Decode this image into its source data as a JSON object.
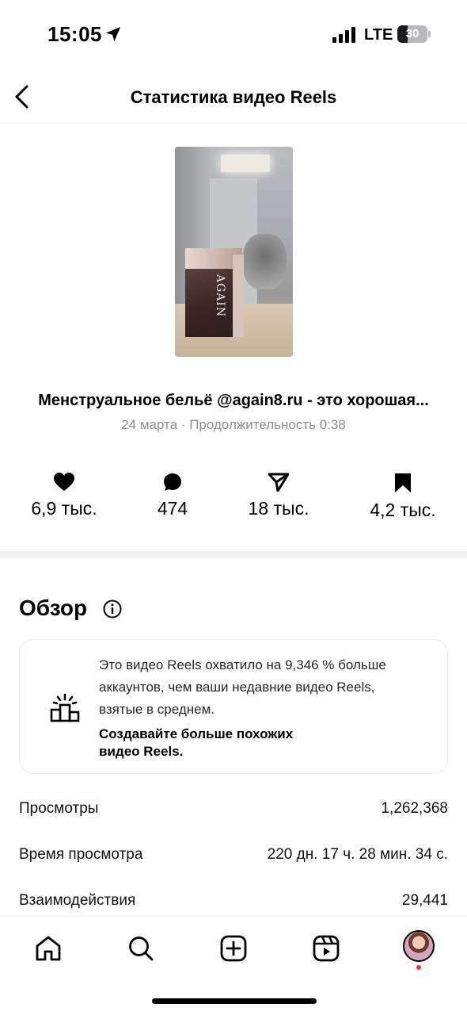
{
  "status_bar": {
    "time": "15:05",
    "network": "LTE",
    "battery": "30"
  },
  "header": {
    "title": "Статистика видео Reels"
  },
  "reel": {
    "caption": "Менструальное бельё @again8.ru - это хорошая...",
    "meta": "24 марта · Продолжительность 0:38",
    "thumbnail_text": "AGAIN"
  },
  "engagement": [
    {
      "icon": "heart-icon",
      "value": "6,9 тыс."
    },
    {
      "icon": "comment-icon",
      "value": "474"
    },
    {
      "icon": "share-icon",
      "value": "18 тыс."
    },
    {
      "icon": "bookmark-icon",
      "value": "4,2 тыс."
    }
  ],
  "overview": {
    "title": "Обзор",
    "card_text": "Это видео Reels охватило на 9,346 % больше аккаунтов, чем ваши недавние видео Reels, взятые в среднем.",
    "card_cta": "Создавайте больше похожих видео Reels."
  },
  "metrics": [
    {
      "label": "Просмотры",
      "value": "1,262,368"
    },
    {
      "label": "Время просмотра",
      "value": "220 дн. 17 ч. 28 мин. 34 с."
    },
    {
      "label": "Взаимодействия",
      "value": "29,441"
    }
  ],
  "nav": {
    "items": [
      "home-icon",
      "search-icon",
      "create-icon",
      "reels-icon",
      "profile-avatar"
    ],
    "notification_color": "#ff3040"
  }
}
